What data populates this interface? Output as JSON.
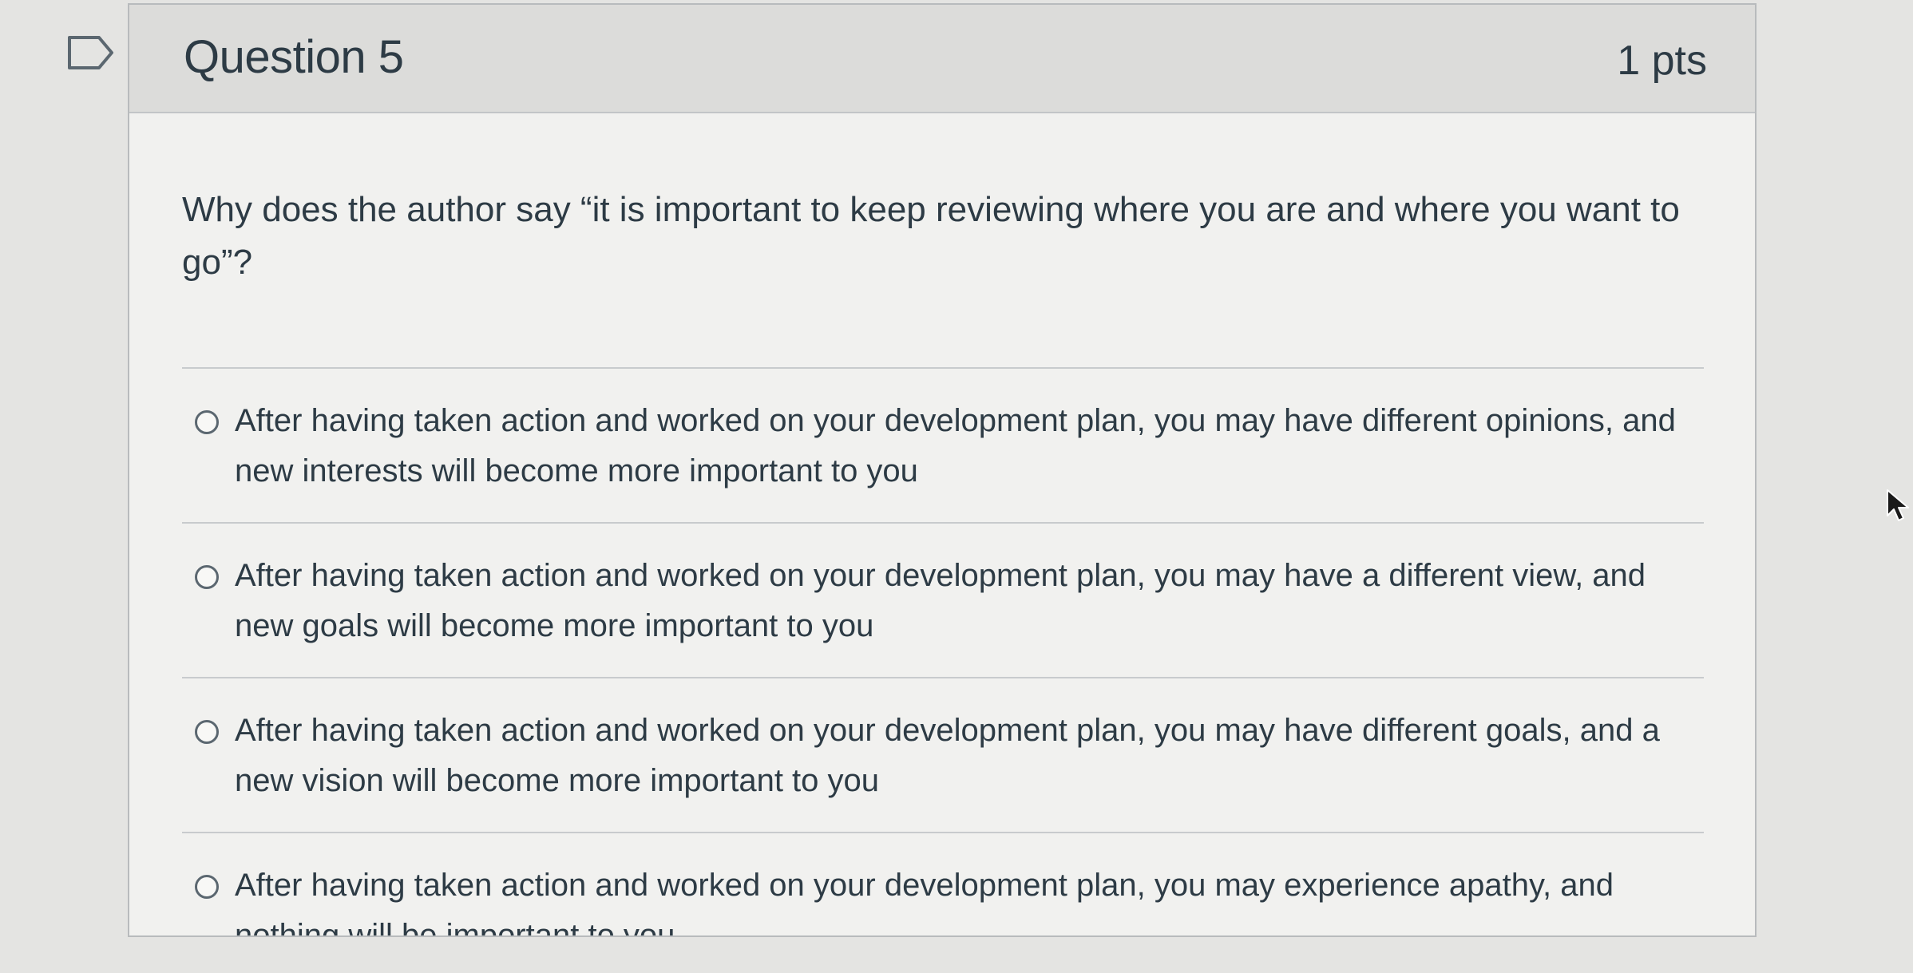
{
  "question": {
    "title": "Question 5",
    "points": "1 pts",
    "text": "Why does the author say “it is important to keep reviewing where you are and where you want to go”?"
  },
  "answers": [
    {
      "label": "After having taken action and worked on your development plan, you may have different opinions, and new interests will become more important to you",
      "selected": false
    },
    {
      "label": "After having taken action and worked on your development plan, you may have a different view, and new goals will become more important to you",
      "selected": false
    },
    {
      "label": "After having taken action and worked on your development plan, you may have different goals, and a new vision will become more important to you",
      "selected": false
    },
    {
      "label": "After having taken action and worked on your development plan, you may experience apathy, and nothing will be important to you",
      "selected": false
    }
  ],
  "icons": {
    "flag": "flag-question-icon",
    "radio": "radio-button-icon",
    "cursor": "mouse-pointer-icon"
  },
  "colors": {
    "header_bg": "#dcdcda",
    "card_bg": "#f1f1ef",
    "text": "#2d3b45",
    "border": "#b8bbbd"
  }
}
